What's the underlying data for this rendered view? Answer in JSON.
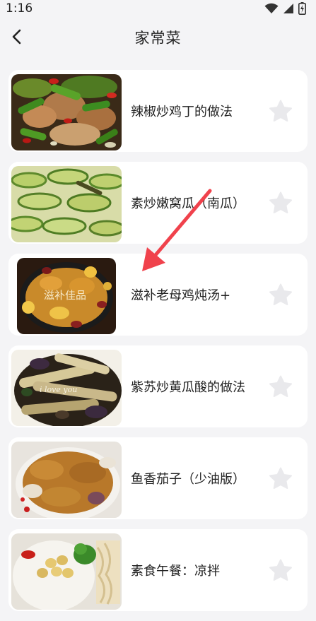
{
  "status_bar": {
    "time": "1:16",
    "icons": [
      "wifi-icon",
      "signal-icon",
      "battery-icon"
    ]
  },
  "header": {
    "back_icon": "back-arrow-icon",
    "title": "家常菜"
  },
  "recipes": [
    {
      "title": "辣椒炒鸡丁的做法",
      "image": "chicken-pepper-stirfry",
      "favorited": false
    },
    {
      "title": "素炒嫩窝瓜（南瓜）",
      "image": "sliced-zucchini",
      "favorited": false
    },
    {
      "title": "滋补老母鸡炖汤+",
      "image": "chicken-soup-pot",
      "image_caption": "滋补佳品",
      "favorited": false
    },
    {
      "title": "紫苏炒黄瓜酸的做法",
      "image": "perilla-cucumber",
      "image_caption": "i love you",
      "favorited": false
    },
    {
      "title": "鱼香茄子（少油版）",
      "image": "yuxiang-eggplant",
      "favorited": false
    },
    {
      "title": "素食午餐：凉拌",
      "image": "veggie-lunch-bowl",
      "favorited": false
    }
  ],
  "colors": {
    "background": "#f4f4f6",
    "card": "#ffffff",
    "star": "#e9e9ec",
    "annotation_arrow": "#f0424c"
  }
}
